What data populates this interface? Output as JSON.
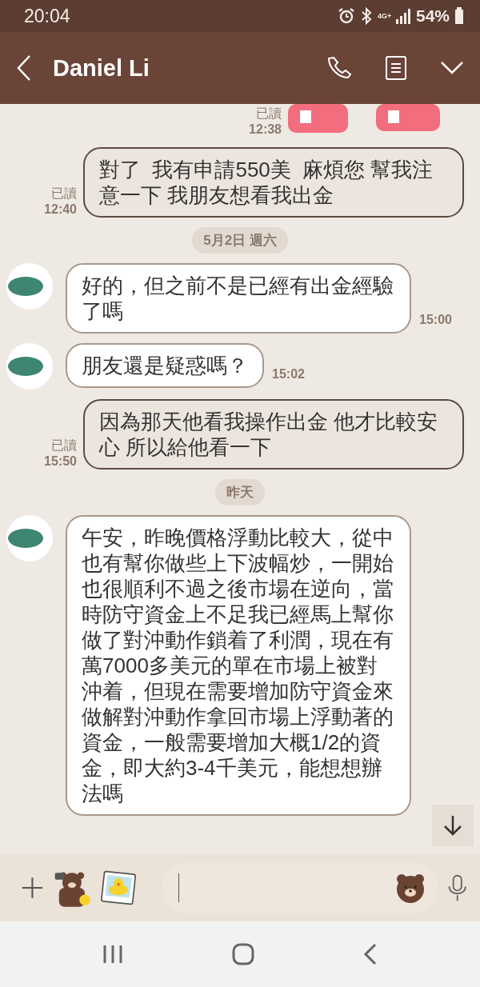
{
  "status_bar": {
    "time": "20:04",
    "network": "4G+",
    "battery": "54%"
  },
  "header": {
    "title": "Daniel Li"
  },
  "messages": [
    {
      "kind": "sticker",
      "read": "已讀",
      "time": "12:38"
    },
    {
      "kind": "outgoing",
      "text": "對了  我有申請550美  麻煩您 幫我注意一下 我朋友想看我出金",
      "read": "已讀",
      "time": "12:40"
    },
    {
      "kind": "date",
      "text": "5月2日 週六"
    },
    {
      "kind": "incoming",
      "text": "好的，但之前不是已經有出金經驗了嗎",
      "time": "15:00"
    },
    {
      "kind": "incoming",
      "text": "朋友還是疑惑嗎？",
      "time": "15:02"
    },
    {
      "kind": "outgoing",
      "text": "因為那天他看我操作出金 他才比較安心 所以給他看一下",
      "read": "已讀",
      "time": "15:50"
    },
    {
      "kind": "date",
      "text": "昨天"
    },
    {
      "kind": "incoming",
      "text": "午安，昨晚價格浮動比較大，從中也有幫你做些上下波幅炒，一開始也很順利不過之後市場在逆向，當時防守資金上不足我已經馬上幫你做了對沖動作鎖着了利潤，現在有萬7000多美元的單在市場上被對沖着，但現在需要增加防守資金來做解對沖動作拿回市場上浮動著的資金，一般需要增加大概1/2的資金，即大約3-4千美元，能想想辦法嗎"
    }
  ]
}
